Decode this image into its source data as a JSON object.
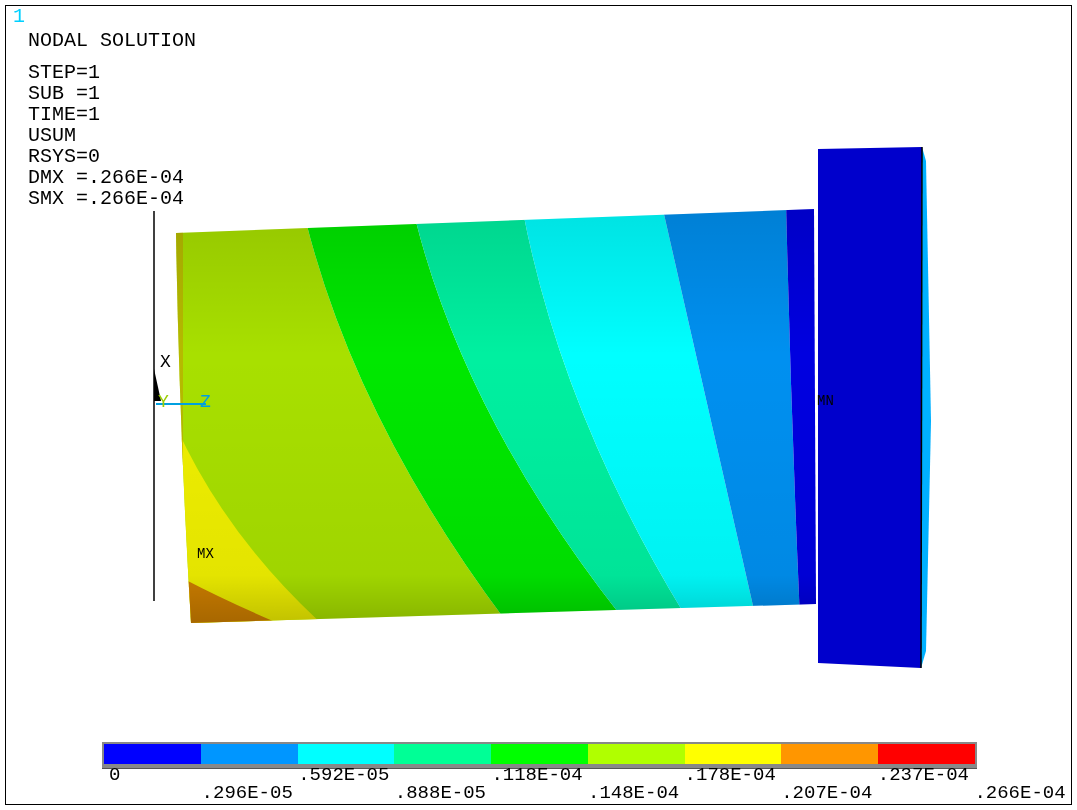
{
  "window": {
    "number": "1"
  },
  "header": {
    "title": "NODAL SOLUTION",
    "info": [
      "STEP=1",
      "SUB =1",
      "TIME=1",
      "USUM",
      "RSYS=0",
      "DMX =.266E-04",
      "SMX =.266E-04"
    ]
  },
  "model": {
    "max_label": "MX",
    "min_label": "MN"
  },
  "triad": {
    "axes": [
      {
        "label": "X"
      },
      {
        "label": "Y"
      },
      {
        "label": "Z"
      }
    ]
  },
  "legend": {
    "bands": [
      {
        "color": "#0000ff"
      },
      {
        "color": "#0096ff"
      },
      {
        "color": "#00ffff"
      },
      {
        "color": "#00ff96"
      },
      {
        "color": "#00ff00"
      },
      {
        "color": "#b0ff00"
      },
      {
        "color": "#ffff00"
      },
      {
        "color": "#ff9600"
      },
      {
        "color": "#ff0000"
      }
    ],
    "labels": [
      "0",
      ".296E-05",
      ".592E-05",
      ".888E-05",
      ".118E-04",
      ".148E-04",
      ".178E-04",
      ".207E-04",
      ".237E-04",
      ".266E-04"
    ]
  }
}
